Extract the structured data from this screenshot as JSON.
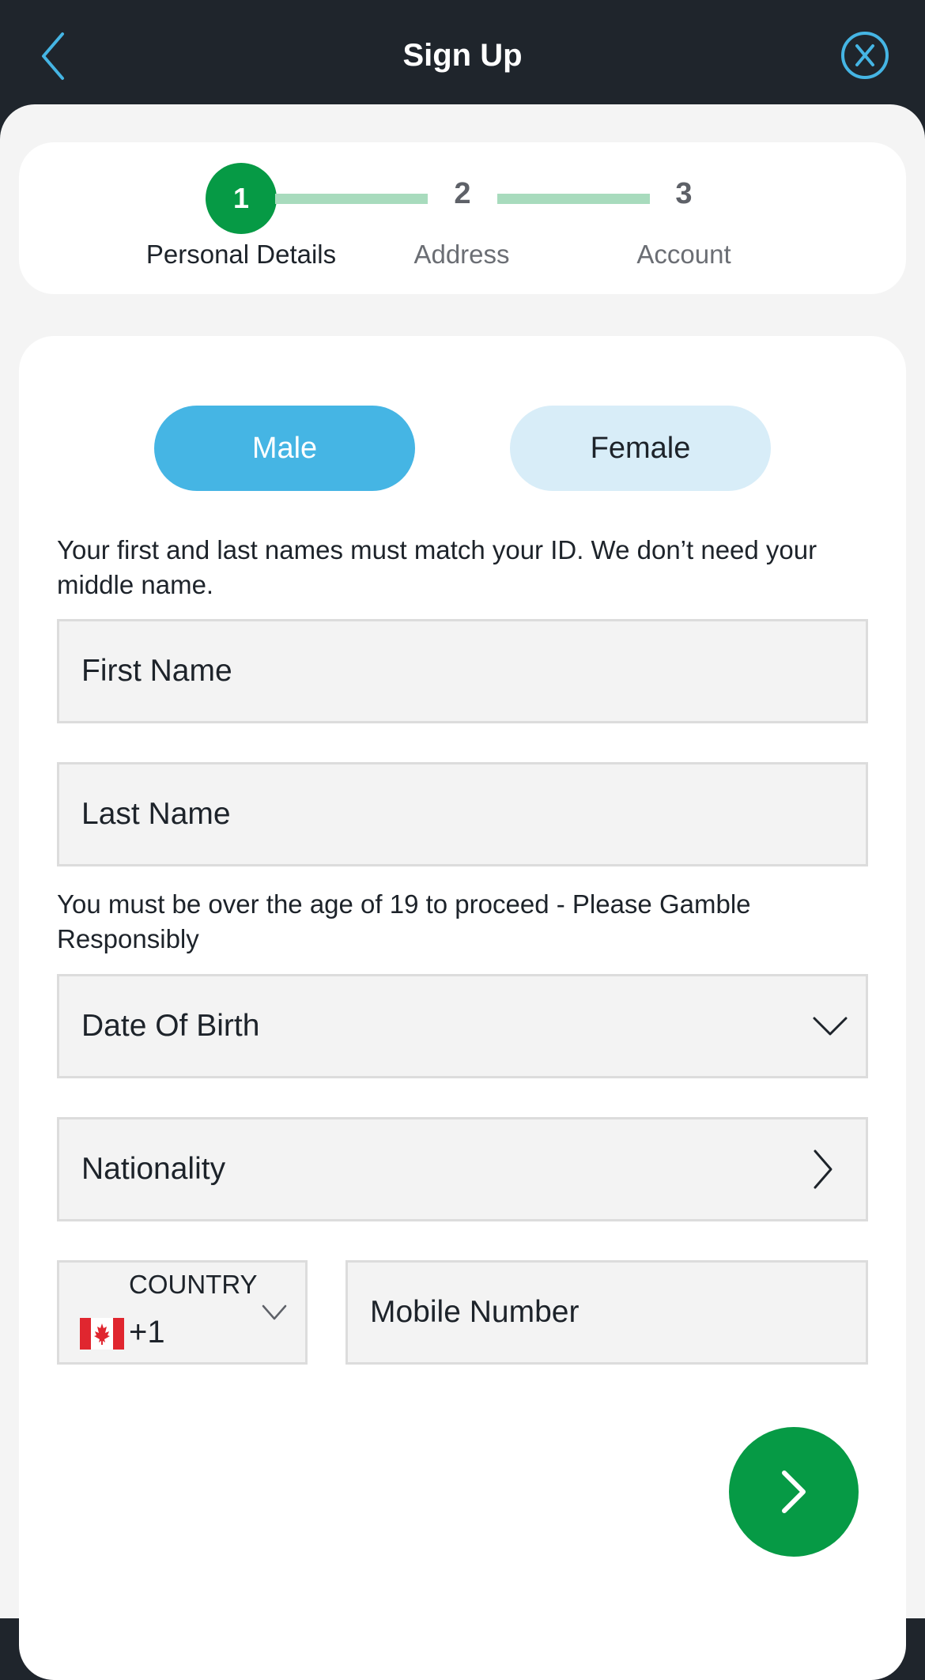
{
  "header": {
    "title": "Sign Up",
    "back_icon": "chevron-left-icon",
    "close_icon": "close-circle-icon",
    "accent_color": "#45b5e4"
  },
  "stepper": {
    "steps": [
      {
        "number": "1",
        "label": "Personal Details",
        "state": "active"
      },
      {
        "number": "2",
        "label": "Address",
        "state": "inactive"
      },
      {
        "number": "3",
        "label": "Account",
        "state": "inactive"
      }
    ],
    "active_color": "#069a45",
    "line_color": "#a8dbbd"
  },
  "gender": {
    "options": [
      "Male",
      "Female"
    ],
    "selected": "Male"
  },
  "form": {
    "name_hint": "Your first and last names must match your ID. We don’t need your middle name.",
    "first_name_placeholder": "First Name",
    "last_name_placeholder": "Last Name",
    "age_hint": "You must be over the age of 19 to proceed - Please Gamble Responsibly",
    "dob_placeholder": "Date Of Birth",
    "nationality_placeholder": "Nationality",
    "country_label": "COUNTRY",
    "country_code": "+1",
    "country_flag": "canada-flag",
    "mobile_placeholder": "Mobile Number"
  },
  "next_button": {
    "icon": "chevron-right-icon",
    "color": "#069a45"
  }
}
